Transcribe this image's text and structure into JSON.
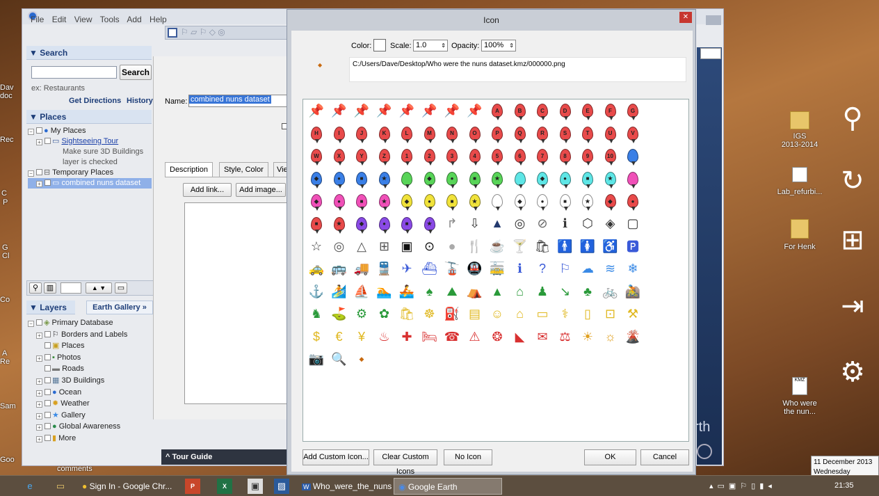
{
  "desktop": {
    "icons_right": [
      {
        "label": "IGS\n2013-2014",
        "icon": "folder-icon"
      },
      {
        "label": "Lab_refurbi...",
        "icon": "document-icon"
      },
      {
        "label": "For Henk",
        "icon": "folder-icon"
      },
      {
        "label": "Who were\nthe nun...",
        "icon": "kmz-icon"
      }
    ],
    "left_fragments": [
      "Dav",
      "doc",
      "Rec",
      "C",
      "P",
      "G",
      "Cl",
      "Co",
      "A",
      "Re",
      "Sam",
      "Goo"
    ],
    "comments_text": "comments",
    "charms": [
      "search-icon",
      "share-icon",
      "windows-start-icon",
      "devices-icon",
      "settings-icon"
    ]
  },
  "google_earth": {
    "menu": [
      "File",
      "Edit",
      "View",
      "Tools",
      "Add",
      "Help"
    ],
    "search": {
      "header": "▼ Search",
      "button": "Search",
      "hint": "ex: Restaurants",
      "directions": "Get Directions",
      "history": "History",
      "value": ""
    },
    "places": {
      "header": "▼ Places",
      "items": [
        {
          "label": "My Places",
          "indent": 0
        },
        {
          "label": "Sightseeing Tour",
          "indent": 1,
          "link": true
        },
        {
          "label": "Make sure 3D Buildings",
          "indent": 2
        },
        {
          "label": "layer is checked",
          "indent": 2
        },
        {
          "label": "Temporary Places",
          "indent": 0
        },
        {
          "label": "combined nuns dataset",
          "indent": 1,
          "selected": true
        }
      ]
    },
    "layers": {
      "header": "▼ Layers",
      "gallery_tab": "Earth Gallery »",
      "items": [
        "Primary Database",
        "Borders and Labels",
        "Places",
        "Photos",
        "Roads",
        "3D Buildings",
        "Ocean",
        "Weather",
        "Gallery",
        "Global Awareness",
        "More"
      ]
    },
    "tour_guide": "^ Tour Guide",
    "name_label": "Name:",
    "name_value": "combined nuns dataset",
    "tabs": [
      "Description",
      "Style, Color",
      "View"
    ],
    "add_link": "Add link...",
    "add_image": "Add image...",
    "earth_fragment": "rth"
  },
  "icon_dialog": {
    "title": "Icon",
    "color_label": "Color:",
    "scale_label": "Scale:",
    "scale_value": "1.0",
    "opacity_label": "Opacity:",
    "opacity_value": "100%",
    "path": "C:/Users/Dave/Desktop/Who were the nuns dataset.kmz/000000.png",
    "buttons": {
      "add_custom": "Add Custom Icon...",
      "clear_custom": "Clear Custom Icons",
      "no_icon": "No Icon",
      "ok": "OK",
      "cancel": "Cancel"
    },
    "icons": [
      [
        {
          "c": "#f2e21a",
          "t": "📌"
        },
        {
          "c": "#2a6fe0",
          "t": "📌"
        },
        {
          "c": "#28b23a",
          "t": "📌"
        },
        {
          "c": "#3fb3b3",
          "t": "📌"
        },
        {
          "c": "#d84fd0",
          "t": "📌"
        },
        {
          "c": "#7a3fd6",
          "t": "📌"
        },
        {
          "c": "#e03a3a",
          "t": "📌"
        },
        {
          "c": "#ffffff",
          "t": "📌"
        },
        {
          "c": "#e84a4a",
          "t": "A"
        },
        {
          "c": "#e84a4a",
          "t": "B"
        },
        {
          "c": "#e84a4a",
          "t": "C"
        },
        {
          "c": "#e84a4a",
          "t": "D"
        },
        {
          "c": "#e84a4a",
          "t": "E"
        },
        {
          "c": "#e84a4a",
          "t": "F"
        },
        {
          "c": "#e84a4a",
          "t": "G"
        }
      ],
      [
        {
          "c": "#e84a4a",
          "t": "H"
        },
        {
          "c": "#e84a4a",
          "t": "I"
        },
        {
          "c": "#e84a4a",
          "t": "J"
        },
        {
          "c": "#e84a4a",
          "t": "K"
        },
        {
          "c": "#e84a4a",
          "t": "L"
        },
        {
          "c": "#e84a4a",
          "t": "M"
        },
        {
          "c": "#e84a4a",
          "t": "N"
        },
        {
          "c": "#e84a4a",
          "t": "O"
        },
        {
          "c": "#e84a4a",
          "t": "P"
        },
        {
          "c": "#e84a4a",
          "t": "Q"
        },
        {
          "c": "#e84a4a",
          "t": "R"
        },
        {
          "c": "#e84a4a",
          "t": "S"
        },
        {
          "c": "#e84a4a",
          "t": "T"
        },
        {
          "c": "#e84a4a",
          "t": "U"
        },
        {
          "c": "#e84a4a",
          "t": "V"
        }
      ],
      [
        {
          "c": "#e84a4a",
          "t": "W"
        },
        {
          "c": "#e84a4a",
          "t": "X"
        },
        {
          "c": "#e84a4a",
          "t": "Y"
        },
        {
          "c": "#e84a4a",
          "t": "Z"
        },
        {
          "c": "#e84a4a",
          "t": "1"
        },
        {
          "c": "#e84a4a",
          "t": "2"
        },
        {
          "c": "#e84a4a",
          "t": "3"
        },
        {
          "c": "#e84a4a",
          "t": "4"
        },
        {
          "c": "#e84a4a",
          "t": "5"
        },
        {
          "c": "#e84a4a",
          "t": "6"
        },
        {
          "c": "#e84a4a",
          "t": "7"
        },
        {
          "c": "#e84a4a",
          "t": "8"
        },
        {
          "c": "#e84a4a",
          "t": "9"
        },
        {
          "c": "#e84a4a",
          "t": "10"
        },
        {
          "c": "#3a7fe6",
          "t": ""
        }
      ],
      [
        {
          "c": "#3a7fe6",
          "t": "◆"
        },
        {
          "c": "#3a7fe6",
          "t": "●"
        },
        {
          "c": "#3a7fe6",
          "t": "■"
        },
        {
          "c": "#3a7fe6",
          "t": "★"
        },
        {
          "c": "#58d458",
          "t": ""
        },
        {
          "c": "#58d458",
          "t": "◆"
        },
        {
          "c": "#58d458",
          "t": "●"
        },
        {
          "c": "#58d458",
          "t": "■"
        },
        {
          "c": "#58d458",
          "t": "★"
        },
        {
          "c": "#5ee6e6",
          "t": ""
        },
        {
          "c": "#5ee6e6",
          "t": "◆"
        },
        {
          "c": "#5ee6e6",
          "t": "●"
        },
        {
          "c": "#5ee6e6",
          "t": "■"
        },
        {
          "c": "#5ee6e6",
          "t": "★"
        },
        {
          "c": "#f050b8",
          "t": ""
        }
      ],
      [
        {
          "c": "#f050b8",
          "t": "◆"
        },
        {
          "c": "#f050b8",
          "t": "●"
        },
        {
          "c": "#f050b8",
          "t": "■"
        },
        {
          "c": "#f050b8",
          "t": "★"
        },
        {
          "c": "#f0e23a",
          "t": "◆"
        },
        {
          "c": "#f0e23a",
          "t": "●"
        },
        {
          "c": "#f0e23a",
          "t": "■"
        },
        {
          "c": "#f0e23a",
          "t": "★"
        },
        {
          "c": "#ffffff",
          "t": ""
        },
        {
          "c": "#ffffff",
          "t": "◆"
        },
        {
          "c": "#ffffff",
          "t": "●"
        },
        {
          "c": "#ffffff",
          "t": "■"
        },
        {
          "c": "#ffffff",
          "t": "★"
        },
        {
          "c": "#e84a4a",
          "t": "◆"
        },
        {
          "c": "#e84a4a",
          "t": "●"
        }
      ],
      [
        {
          "c": "#e84a4a",
          "t": "■"
        },
        {
          "c": "#e84a4a",
          "t": "★"
        },
        {
          "c": "#8a4ae6",
          "t": "◆"
        },
        {
          "c": "#8a4ae6",
          "t": "●"
        },
        {
          "c": "#8a4ae6",
          "t": "■"
        },
        {
          "c": "#8a4ae6",
          "t": "★"
        },
        {
          "g": "↱",
          "c": "#888"
        },
        {
          "g": "⇩",
          "c": "#333"
        },
        {
          "g": "▲",
          "c": "#233a6e"
        },
        {
          "g": "◎",
          "c": "#333"
        },
        {
          "g": "⊘",
          "c": "#666"
        },
        {
          "g": "ℹ",
          "c": "#333"
        },
        {
          "g": "⬡",
          "c": "#333"
        },
        {
          "g": "◈",
          "c": "#333"
        },
        {
          "g": "▢",
          "c": "#333"
        }
      ],
      [
        {
          "g": "☆",
          "c": "#333"
        },
        {
          "g": "◎",
          "c": "#555"
        },
        {
          "g": "△",
          "c": "#555"
        },
        {
          "g": "⊞",
          "c": "#555"
        },
        {
          "g": "▣",
          "c": "#111"
        },
        {
          "g": "⊙",
          "c": "#111"
        },
        {
          "g": "●",
          "c": "#aaa"
        },
        {
          "g": "🍴",
          "c": "#333"
        },
        {
          "g": "☕",
          "c": "#333"
        },
        {
          "g": "🍸",
          "c": "#333"
        },
        {
          "g": "🛍",
          "c": "#333"
        },
        {
          "g": "🚹",
          "c": "#333"
        },
        {
          "g": "🚺",
          "c": "#333"
        },
        {
          "g": "♿",
          "c": "#333"
        },
        {
          "g": "🅿",
          "c": "#3a5ad8"
        }
      ],
      [
        {
          "g": "🚕",
          "c": "#3a5ad8"
        },
        {
          "g": "🚌",
          "c": "#3a5ad8"
        },
        {
          "g": "🚚",
          "c": "#3a5ad8"
        },
        {
          "g": "🚆",
          "c": "#3a5ad8"
        },
        {
          "g": "✈",
          "c": "#3a5ad8"
        },
        {
          "g": "⛴",
          "c": "#3a5ad8"
        },
        {
          "g": "🚡",
          "c": "#3a5ad8"
        },
        {
          "g": "🚇",
          "c": "#3a5ad8"
        },
        {
          "g": "🚋",
          "c": "#3a5ad8"
        },
        {
          "g": "ℹ",
          "c": "#3a5ad8"
        },
        {
          "g": "?",
          "c": "#3a5ad8"
        },
        {
          "g": "⚐",
          "c": "#3a5ad8"
        },
        {
          "g": "☁",
          "c": "#3a8ae6"
        },
        {
          "g": "≋",
          "c": "#3a8ae6"
        },
        {
          "g": "❄",
          "c": "#3a8ae6"
        }
      ],
      [
        {
          "g": "⚓",
          "c": "#2a6ad0"
        },
        {
          "g": "🏄",
          "c": "#2a6ad0"
        },
        {
          "g": "⛵",
          "c": "#2a6ad0"
        },
        {
          "g": "🏊",
          "c": "#2a6ad0"
        },
        {
          "g": "🚣",
          "c": "#2a6ad0"
        },
        {
          "g": "♠",
          "c": "#2a9a3a"
        },
        {
          "g": "⛰",
          "c": "#2a9a3a"
        },
        {
          "g": "⛺",
          "c": "#2a9a3a"
        },
        {
          "g": "▲",
          "c": "#2a9a3a"
        },
        {
          "g": "⌂",
          "c": "#2a9a3a"
        },
        {
          "g": "♟",
          "c": "#2a9a3a"
        },
        {
          "g": "↘",
          "c": "#2a9a3a"
        },
        {
          "g": "♣",
          "c": "#2a9a3a"
        },
        {
          "g": "🚲",
          "c": "#2a9a3a"
        },
        {
          "g": "🚵",
          "c": "#2a9a3a"
        }
      ],
      [
        {
          "g": "♞",
          "c": "#2a9a3a"
        },
        {
          "g": "⛳",
          "c": "#2a9a3a"
        },
        {
          "g": "⚙",
          "c": "#2a9a3a"
        },
        {
          "g": "✿",
          "c": "#2a9a3a"
        },
        {
          "g": "🛍",
          "c": "#e0b820"
        },
        {
          "g": "☸",
          "c": "#e0b820"
        },
        {
          "g": "⛽",
          "c": "#e0b820"
        },
        {
          "g": "▤",
          "c": "#e0b820"
        },
        {
          "g": "☺",
          "c": "#e0b820"
        },
        {
          "g": "⌂",
          "c": "#e0b820"
        },
        {
          "g": "▭",
          "c": "#e0b820"
        },
        {
          "g": "⚕",
          "c": "#e0b820"
        },
        {
          "g": "▯",
          "c": "#e0b820"
        },
        {
          "g": "⊡",
          "c": "#e0b820"
        },
        {
          "g": "⚒",
          "c": "#e0b820"
        }
      ],
      [
        {
          "g": "$",
          "c": "#e0b820"
        },
        {
          "g": "€",
          "c": "#e0b820"
        },
        {
          "g": "¥",
          "c": "#e0b820"
        },
        {
          "g": "♨",
          "c": "#d83030"
        },
        {
          "g": "✚",
          "c": "#d83030"
        },
        {
          "g": "🛏",
          "c": "#d83030"
        },
        {
          "g": "☎",
          "c": "#d83030"
        },
        {
          "g": "⚠",
          "c": "#d83030"
        },
        {
          "g": "❂",
          "c": "#d83030"
        },
        {
          "g": "◣",
          "c": "#d83030"
        },
        {
          "g": "✉",
          "c": "#d83030"
        },
        {
          "g": "⚖",
          "c": "#d83030"
        },
        {
          "g": "☀",
          "c": "#e0a020"
        },
        {
          "g": "☼",
          "c": "#e0a020"
        },
        {
          "g": "🌋",
          "c": "#e06020"
        }
      ],
      [
        {
          "g": "📷",
          "c": "#9a3ab8"
        },
        {
          "g": "🔍",
          "c": "#9a3ab8"
        },
        {
          "g": "◆",
          "c": "#c86a10",
          "small": true
        }
      ]
    ]
  },
  "taskbar": {
    "items": [
      {
        "label": "",
        "icon": "ie-icon"
      },
      {
        "label": "",
        "icon": "explorer-icon"
      },
      {
        "label": "Sign In - Google Chr...",
        "icon": "chrome-icon"
      },
      {
        "label": "",
        "icon": "powerpoint-icon"
      },
      {
        "label": "",
        "icon": "excel-icon"
      },
      {
        "label": "",
        "icon": "app-icon"
      },
      {
        "label": "",
        "icon": "app2-icon"
      },
      {
        "label": "Who_were_the_nuns...",
        "icon": "word-icon"
      },
      {
        "label": "Google Earth",
        "icon": "google-earth-icon",
        "active": true
      }
    ],
    "time": "21:35",
    "date_popup": "11 December 2013",
    "day_popup": "Wednesday"
  }
}
